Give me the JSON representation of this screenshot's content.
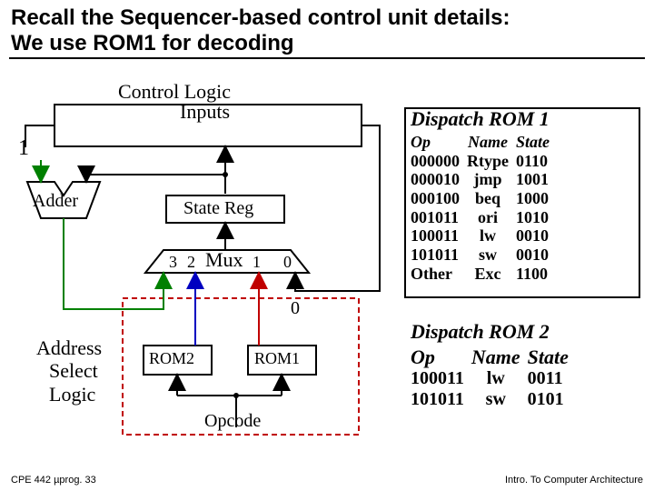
{
  "title_line1": "Recall the Sequencer-based control unit details:",
  "title_line2": "We use ROM1 for decoding",
  "footer_left": "CPE 442  µprog. 33",
  "footer_right": "Intro. To Computer Architecture",
  "labels": {
    "control_logic": "Control Logic",
    "inputs": "Inputs",
    "one": "1",
    "adder": "Adder",
    "state_reg": "State Reg",
    "mux": "Mux",
    "mux3": "3",
    "mux2": "2",
    "mux1": "1",
    "mux0": "0",
    "zero_out": "0",
    "rom2": "ROM2",
    "rom1": "ROM1",
    "address_select_logic_1": "Address",
    "address_select_logic_2": "Select",
    "address_select_logic_3": "Logic",
    "opcode": "Opcode"
  },
  "rom1": {
    "title": "Dispatch ROM 1",
    "headers": [
      "Op",
      "Name",
      "State"
    ],
    "rows": [
      [
        "000000",
        "Rtype",
        "0110"
      ],
      [
        "000010",
        "jmp",
        "1001"
      ],
      [
        "000100",
        "beq",
        "1000"
      ],
      [
        "001011",
        "ori",
        "1010"
      ],
      [
        "100011",
        "lw",
        "0010"
      ],
      [
        "101011",
        "sw",
        "0010"
      ],
      [
        "Other",
        "Exc",
        "1100"
      ]
    ]
  },
  "rom2": {
    "title": "Dispatch ROM 2",
    "headers": [
      "Op",
      "Name",
      "State"
    ],
    "rows": [
      [
        "100011",
        "lw",
        "0011"
      ],
      [
        "101011",
        "sw",
        "0101"
      ]
    ]
  }
}
